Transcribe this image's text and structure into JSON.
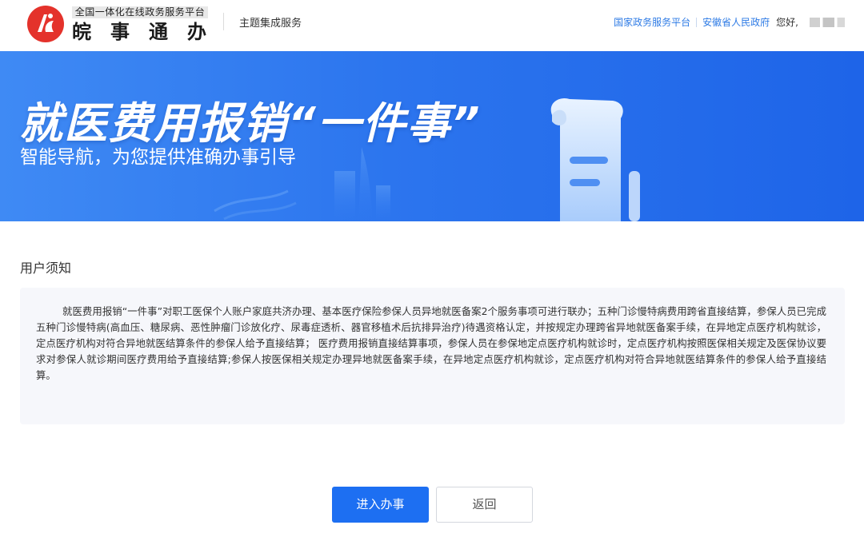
{
  "header": {
    "platform_tag": "全国一体化在线政务服务平台",
    "brand": "皖事通办",
    "service": "主题集成服务",
    "links": [
      "国家政务服务平台",
      "安徽省人民政府"
    ],
    "greeting": "您好,"
  },
  "banner": {
    "title": "就医费用报销“一件事”",
    "subtitle": "智能导航，为您提供准确办事引导"
  },
  "notice": {
    "title": "用户须知",
    "body": "就医费用报销“一件事”对职工医保个人账户家庭共济办理、基本医疗保险参保人员异地就医备案2个服务事项可进行联办；五种门诊慢特病费用跨省直接结算，参保人员已完成五种门诊慢特病(高血压、糖尿病、恶性肿瘤门诊放化疗、尿毒症透析、器官移植术后抗排异治疗)待遇资格认定，并按规定办理跨省异地就医备案手续，在异地定点医疗机构就诊，定点医疗机构对符合异地就医结算条件的参保人给予直接结算； 医疗费用报销直接结算事项，参保人员在参保地定点医疗机构就诊时，定点医疗机构按照医保相关规定及医保协议要求对参保人就诊期间医疗费用给予直接结算;参保人按医保相关规定办理异地就医备案手续，在异地定点医疗机构就诊，定点医疗机构对符合异地就医结算条件的参保人给予直接结算。"
  },
  "actions": {
    "enter": "进入办事",
    "back": "返回"
  },
  "colors": {
    "accent": "#1d6ff2",
    "banner_start": "#3f8af4",
    "banner_end": "#1e64e8",
    "logo_red": "#e4322b"
  },
  "icons": {
    "logo": "anhui-logo-icon"
  }
}
